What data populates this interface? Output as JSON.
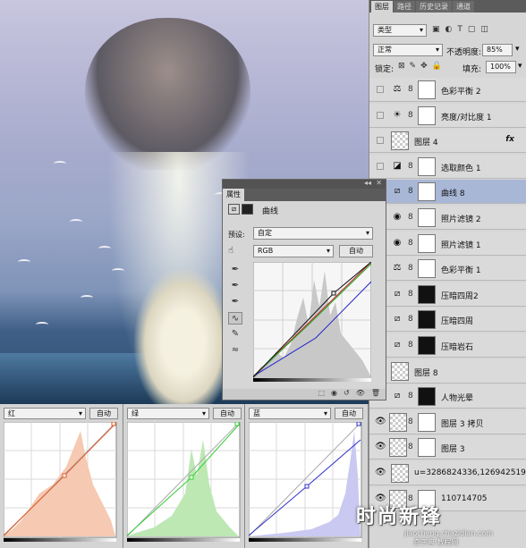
{
  "layers_panel": {
    "tabs": [
      "图层",
      "路径",
      "历史记录",
      "通道"
    ],
    "filter_kind": "类型",
    "blend_mode": "正常",
    "opacity_label": "不透明度:",
    "opacity_value": "85%",
    "lock_label": "锁定:",
    "fill_label": "填充:",
    "fill_value": "100%",
    "layers": [
      {
        "name": "色彩平衡 2",
        "icon": "balance-icon",
        "visible": false,
        "kind": "adjust"
      },
      {
        "name": "亮度/对比度 1",
        "icon": "brightness-icon",
        "visible": false,
        "kind": "adjust"
      },
      {
        "name": "图层 4",
        "visible": false,
        "kind": "pixel",
        "fx": "fx"
      },
      {
        "name": "选取颜色 1",
        "icon": "selective-color-icon",
        "visible": false,
        "kind": "adjust"
      },
      {
        "name": "曲线 8",
        "icon": "curves-icon",
        "visible": false,
        "kind": "adjust",
        "selected": true
      },
      {
        "name": "照片滤镜 2",
        "icon": "photo-filter-icon",
        "visible": false,
        "kind": "adjust"
      },
      {
        "name": "照片滤镜 1",
        "icon": "photo-filter-icon",
        "visible": false,
        "kind": "adjust"
      },
      {
        "name": "色彩平衡 1",
        "icon": "balance-icon",
        "visible": false,
        "kind": "adjust"
      },
      {
        "name": "压暗四周2",
        "icon": "curves-icon",
        "visible": false,
        "kind": "mask"
      },
      {
        "name": "压暗四周",
        "icon": "curves-icon",
        "visible": false,
        "kind": "mask"
      },
      {
        "name": "压暗岩石",
        "icon": "curves-icon",
        "visible": false,
        "kind": "mask"
      },
      {
        "name": "图层 8",
        "visible": false,
        "kind": "pixel"
      },
      {
        "name": "人物光晕",
        "icon": "curves-icon",
        "visible": false,
        "kind": "mask"
      },
      {
        "name": "图层 3 拷贝",
        "visible": true,
        "kind": "pixel-mask"
      },
      {
        "name": "图层 3",
        "visible": true,
        "kind": "pixel-mask"
      },
      {
        "name": "u=3286824336,126942519...",
        "visible": true,
        "kind": "pixel"
      },
      {
        "name": "110714705",
        "visible": true,
        "kind": "pixel-mask"
      }
    ]
  },
  "properties_panel": {
    "tab": "属性",
    "title": "曲线",
    "preset_label": "预设:",
    "preset_value": "自定",
    "channel": "RGB",
    "auto_button": "自动"
  },
  "bottom_curves": [
    {
      "channel": "红",
      "auto": "自动",
      "color": "#e0592b",
      "hist": "#f6c9b2"
    },
    {
      "channel": "绿",
      "auto": "自动",
      "color": "#33cc33",
      "hist": "#bde8b3"
    },
    {
      "channel": "蓝",
      "auto": "自动",
      "color": "#3030c8",
      "hist": "#c9c9f2"
    }
  ],
  "watermark": {
    "title": "时尚新锋",
    "subtitle": "jiaocheng.chazidian.com",
    "overlay": "查字典 教程网"
  }
}
